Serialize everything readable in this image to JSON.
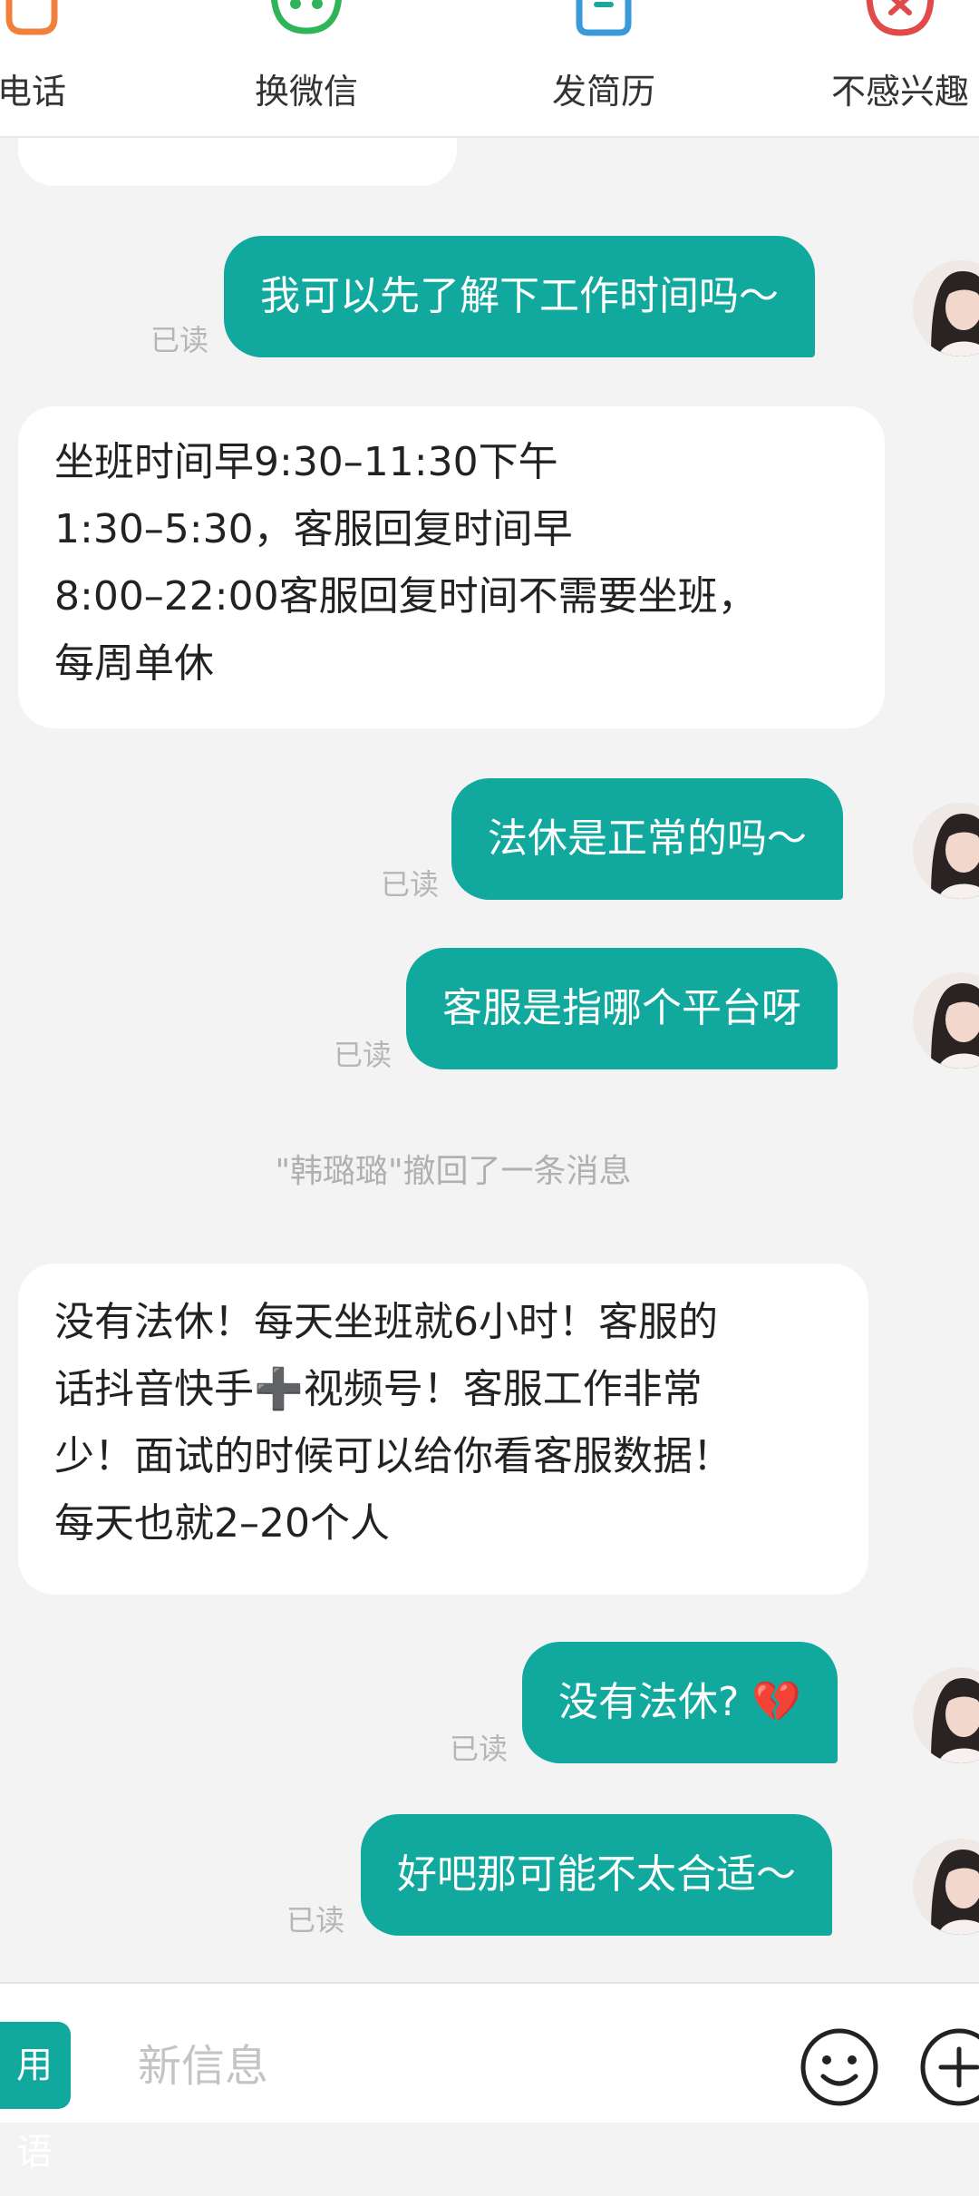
{
  "toolbar": {
    "actions": [
      {
        "label": "电话"
      },
      {
        "label": "换微信"
      },
      {
        "label": "发简历"
      },
      {
        "label": "不感兴趣"
      }
    ]
  },
  "messages": {
    "m1_text": "我可以先了解下工作时间吗～",
    "m1_status": "已读",
    "m2_lines": [
      "坐班时间早9:30–11:30下午",
      "1:30–5:30，客服回复时间早",
      "8:00–22:00客服回复时间不需要坐班，",
      "每周单休"
    ],
    "m3_text": "法休是正常的吗～",
    "m3_status": "已读",
    "m4_text": "客服是指哪个平台呀",
    "m4_status": "已读",
    "system_notice": "\"韩璐璐\"撤回了一条消息",
    "m5_lines": [
      "没有法休！每天坐班就6小时！客服的",
      "话抖音快手➕视频号！客服工作非常",
      "少！面试的时候可以给你看客服数据！",
      "每天也就2–20个人"
    ],
    "m6_text": "没有法休? 💔",
    "m6_status": "已读",
    "m7_text": "好吧那可能不太合适～",
    "m7_status": "已读"
  },
  "composer": {
    "phrases_label": "用语",
    "placeholder": "新信息"
  },
  "colors": {
    "accent": "#11a89e",
    "background": "#f3f3f3"
  }
}
